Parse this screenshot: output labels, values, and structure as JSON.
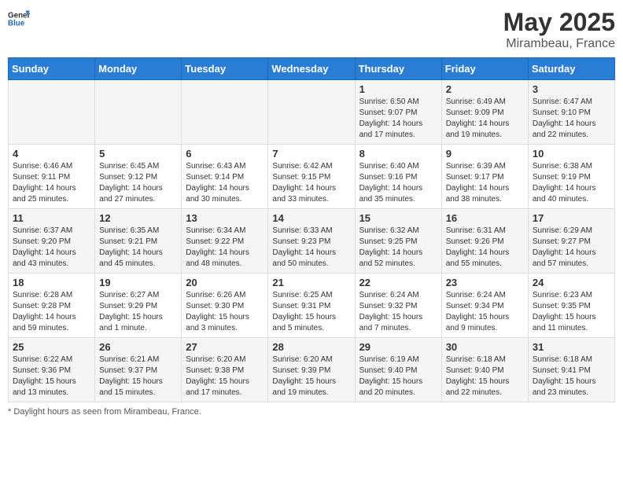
{
  "header": {
    "logo_general": "General",
    "logo_blue": "Blue",
    "main_title": "May 2025",
    "subtitle": "Mirambeau, France"
  },
  "footer": {
    "note": "Daylight hours"
  },
  "weekdays": [
    "Sunday",
    "Monday",
    "Tuesday",
    "Wednesday",
    "Thursday",
    "Friday",
    "Saturday"
  ],
  "weeks": [
    [
      {
        "day": "",
        "info": ""
      },
      {
        "day": "",
        "info": ""
      },
      {
        "day": "",
        "info": ""
      },
      {
        "day": "",
        "info": ""
      },
      {
        "day": "1",
        "info": "Sunrise: 6:50 AM\nSunset: 9:07 PM\nDaylight: 14 hours and 17 minutes."
      },
      {
        "day": "2",
        "info": "Sunrise: 6:49 AM\nSunset: 9:09 PM\nDaylight: 14 hours and 19 minutes."
      },
      {
        "day": "3",
        "info": "Sunrise: 6:47 AM\nSunset: 9:10 PM\nDaylight: 14 hours and 22 minutes."
      }
    ],
    [
      {
        "day": "4",
        "info": "Sunrise: 6:46 AM\nSunset: 9:11 PM\nDaylight: 14 hours and 25 minutes."
      },
      {
        "day": "5",
        "info": "Sunrise: 6:45 AM\nSunset: 9:12 PM\nDaylight: 14 hours and 27 minutes."
      },
      {
        "day": "6",
        "info": "Sunrise: 6:43 AM\nSunset: 9:14 PM\nDaylight: 14 hours and 30 minutes."
      },
      {
        "day": "7",
        "info": "Sunrise: 6:42 AM\nSunset: 9:15 PM\nDaylight: 14 hours and 33 minutes."
      },
      {
        "day": "8",
        "info": "Sunrise: 6:40 AM\nSunset: 9:16 PM\nDaylight: 14 hours and 35 minutes."
      },
      {
        "day": "9",
        "info": "Sunrise: 6:39 AM\nSunset: 9:17 PM\nDaylight: 14 hours and 38 minutes."
      },
      {
        "day": "10",
        "info": "Sunrise: 6:38 AM\nSunset: 9:19 PM\nDaylight: 14 hours and 40 minutes."
      }
    ],
    [
      {
        "day": "11",
        "info": "Sunrise: 6:37 AM\nSunset: 9:20 PM\nDaylight: 14 hours and 43 minutes."
      },
      {
        "day": "12",
        "info": "Sunrise: 6:35 AM\nSunset: 9:21 PM\nDaylight: 14 hours and 45 minutes."
      },
      {
        "day": "13",
        "info": "Sunrise: 6:34 AM\nSunset: 9:22 PM\nDaylight: 14 hours and 48 minutes."
      },
      {
        "day": "14",
        "info": "Sunrise: 6:33 AM\nSunset: 9:23 PM\nDaylight: 14 hours and 50 minutes."
      },
      {
        "day": "15",
        "info": "Sunrise: 6:32 AM\nSunset: 9:25 PM\nDaylight: 14 hours and 52 minutes."
      },
      {
        "day": "16",
        "info": "Sunrise: 6:31 AM\nSunset: 9:26 PM\nDaylight: 14 hours and 55 minutes."
      },
      {
        "day": "17",
        "info": "Sunrise: 6:29 AM\nSunset: 9:27 PM\nDaylight: 14 hours and 57 minutes."
      }
    ],
    [
      {
        "day": "18",
        "info": "Sunrise: 6:28 AM\nSunset: 9:28 PM\nDaylight: 14 hours and 59 minutes."
      },
      {
        "day": "19",
        "info": "Sunrise: 6:27 AM\nSunset: 9:29 PM\nDaylight: 15 hours and 1 minute."
      },
      {
        "day": "20",
        "info": "Sunrise: 6:26 AM\nSunset: 9:30 PM\nDaylight: 15 hours and 3 minutes."
      },
      {
        "day": "21",
        "info": "Sunrise: 6:25 AM\nSunset: 9:31 PM\nDaylight: 15 hours and 5 minutes."
      },
      {
        "day": "22",
        "info": "Sunrise: 6:24 AM\nSunset: 9:32 PM\nDaylight: 15 hours and 7 minutes."
      },
      {
        "day": "23",
        "info": "Sunrise: 6:24 AM\nSunset: 9:34 PM\nDaylight: 15 hours and 9 minutes."
      },
      {
        "day": "24",
        "info": "Sunrise: 6:23 AM\nSunset: 9:35 PM\nDaylight: 15 hours and 11 minutes."
      }
    ],
    [
      {
        "day": "25",
        "info": "Sunrise: 6:22 AM\nSunset: 9:36 PM\nDaylight: 15 hours and 13 minutes."
      },
      {
        "day": "26",
        "info": "Sunrise: 6:21 AM\nSunset: 9:37 PM\nDaylight: 15 hours and 15 minutes."
      },
      {
        "day": "27",
        "info": "Sunrise: 6:20 AM\nSunset: 9:38 PM\nDaylight: 15 hours and 17 minutes."
      },
      {
        "day": "28",
        "info": "Sunrise: 6:20 AM\nSunset: 9:39 PM\nDaylight: 15 hours and 19 minutes."
      },
      {
        "day": "29",
        "info": "Sunrise: 6:19 AM\nSunset: 9:40 PM\nDaylight: 15 hours and 20 minutes."
      },
      {
        "day": "30",
        "info": "Sunrise: 6:18 AM\nSunset: 9:40 PM\nDaylight: 15 hours and 22 minutes."
      },
      {
        "day": "31",
        "info": "Sunrise: 6:18 AM\nSunset: 9:41 PM\nDaylight: 15 hours and 23 minutes."
      }
    ]
  ]
}
